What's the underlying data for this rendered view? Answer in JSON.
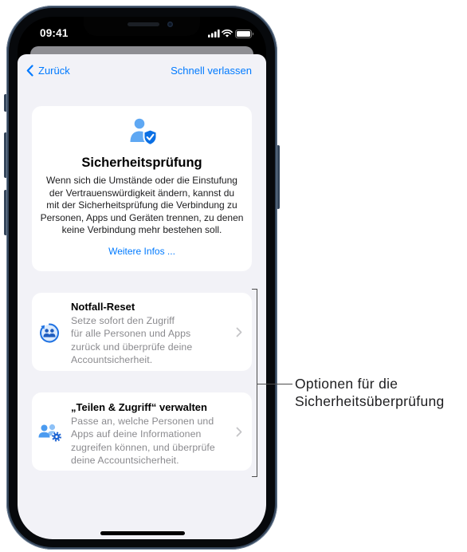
{
  "status_bar": {
    "time": "09:41",
    "signal_icon": "cellular-signal-icon",
    "wifi_icon": "wifi-icon",
    "battery_icon": "battery-icon"
  },
  "nav": {
    "back_icon": "chevron-left-icon",
    "back_label": "Zurück",
    "quick_exit_label": "Schnell verlassen"
  },
  "intro_card": {
    "icon": "person-shield-checkmark-icon",
    "title": "Sicherheitsprüfung",
    "body_lines": [
      "Wenn sich die Umstände oder die Einstufung",
      "der Vertrauenswürdigkeit ändern, kannst du",
      "mit der Sicherheitsprüfung die Verbindung zu",
      "Personen, Apps und Geräten trennen, zu denen",
      "keine Verbindung mehr bestehen soll."
    ],
    "link_label": "Weitere Infos ..."
  },
  "options": [
    {
      "icon": "emergency-reset-icon",
      "title": "Notfall-Reset",
      "body_lines": [
        "Setze sofort den Zugriff",
        "für alle Personen und Apps",
        "zurück und überprüfe deine",
        "Accountsicherheit."
      ],
      "chevron_icon": "chevron-right-icon"
    },
    {
      "icon": "manage-sharing-access-icon",
      "title": "„Teilen & Zugriff“ verwalten",
      "body_lines": [
        "Passe an, welche Personen und",
        "Apps auf deine Informationen",
        "zugreifen können, und überprüfe",
        "deine Accountsicherheit."
      ],
      "chevron_icon": "chevron-right-icon"
    }
  ],
  "callout": {
    "lines": [
      "Optionen für die",
      "Sicherheitsüberprüfung"
    ]
  },
  "colors": {
    "accent": "#007AFF",
    "sheet_background": "#F2F2F7",
    "card_background": "#FFFFFF",
    "secondary_text": "#8A8A8E",
    "icon_blue": "#0A6FE4",
    "phone_frame": "#34455A"
  }
}
